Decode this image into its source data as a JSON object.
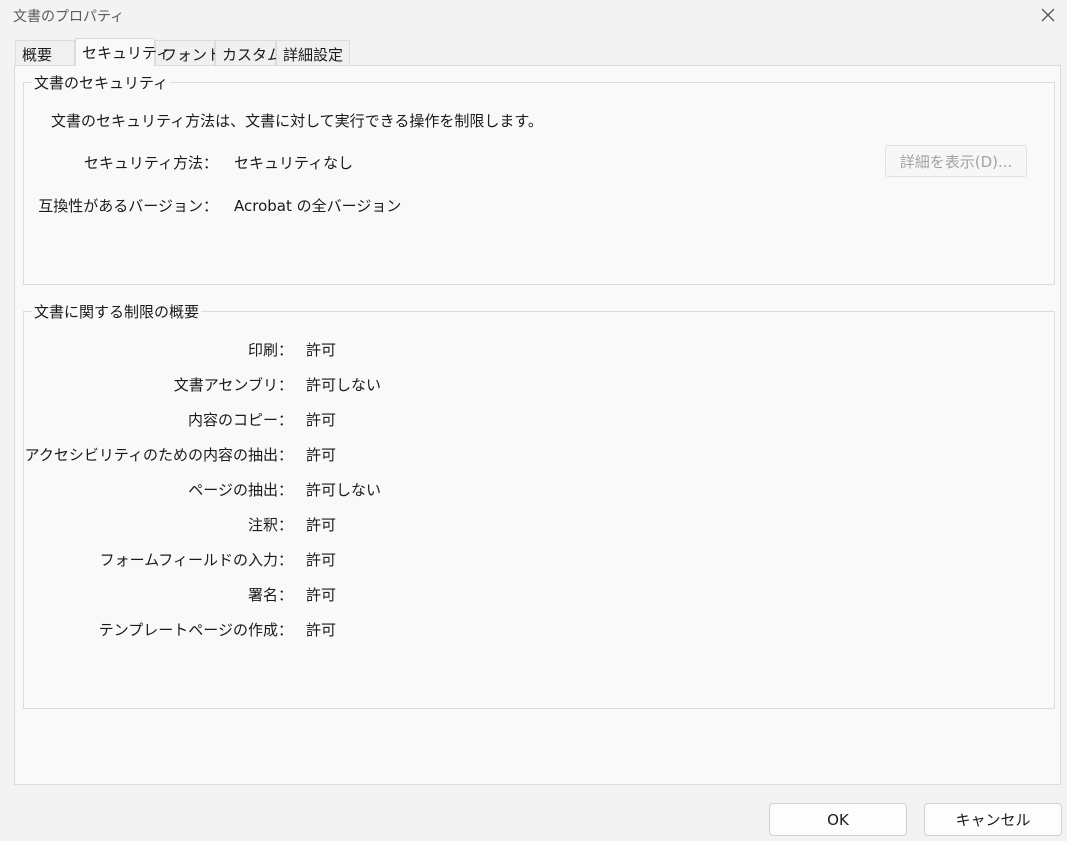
{
  "window": {
    "title": "文書のプロパティ"
  },
  "tabs": [
    "概要",
    "セキュリティ",
    "フォント",
    "カスタム",
    "詳細設定"
  ],
  "security": {
    "legend": "文書のセキュリティ",
    "description": "文書のセキュリティ方法は、文書に対して実行できる操作を制限します。",
    "method_label": "セキュリティ方法：",
    "method_value": "セキュリティなし",
    "compat_label": "互換性があるバージョン：",
    "compat_value": "Acrobat の全バージョン",
    "details_button": "詳細を表示(D)..."
  },
  "restrictions": {
    "legend": "文書に関する制限の概要",
    "items": [
      {
        "label": "印刷：",
        "value": "許可"
      },
      {
        "label": "文書アセンブリ：",
        "value": "許可しない"
      },
      {
        "label": "内容のコピー：",
        "value": "許可"
      },
      {
        "label": "アクセシビリティのための内容の抽出：",
        "value": "許可"
      },
      {
        "label": "ページの抽出：",
        "value": "許可しない"
      },
      {
        "label": "注釈：",
        "value": "許可"
      },
      {
        "label": "フォームフィールドの入力：",
        "value": "許可"
      },
      {
        "label": "署名：",
        "value": "許可"
      },
      {
        "label": "テンプレートページの作成：",
        "value": "許可"
      }
    ]
  },
  "footer": {
    "ok": "OK",
    "cancel": "キャンセル"
  },
  "icons": {
    "close": "close-icon"
  }
}
